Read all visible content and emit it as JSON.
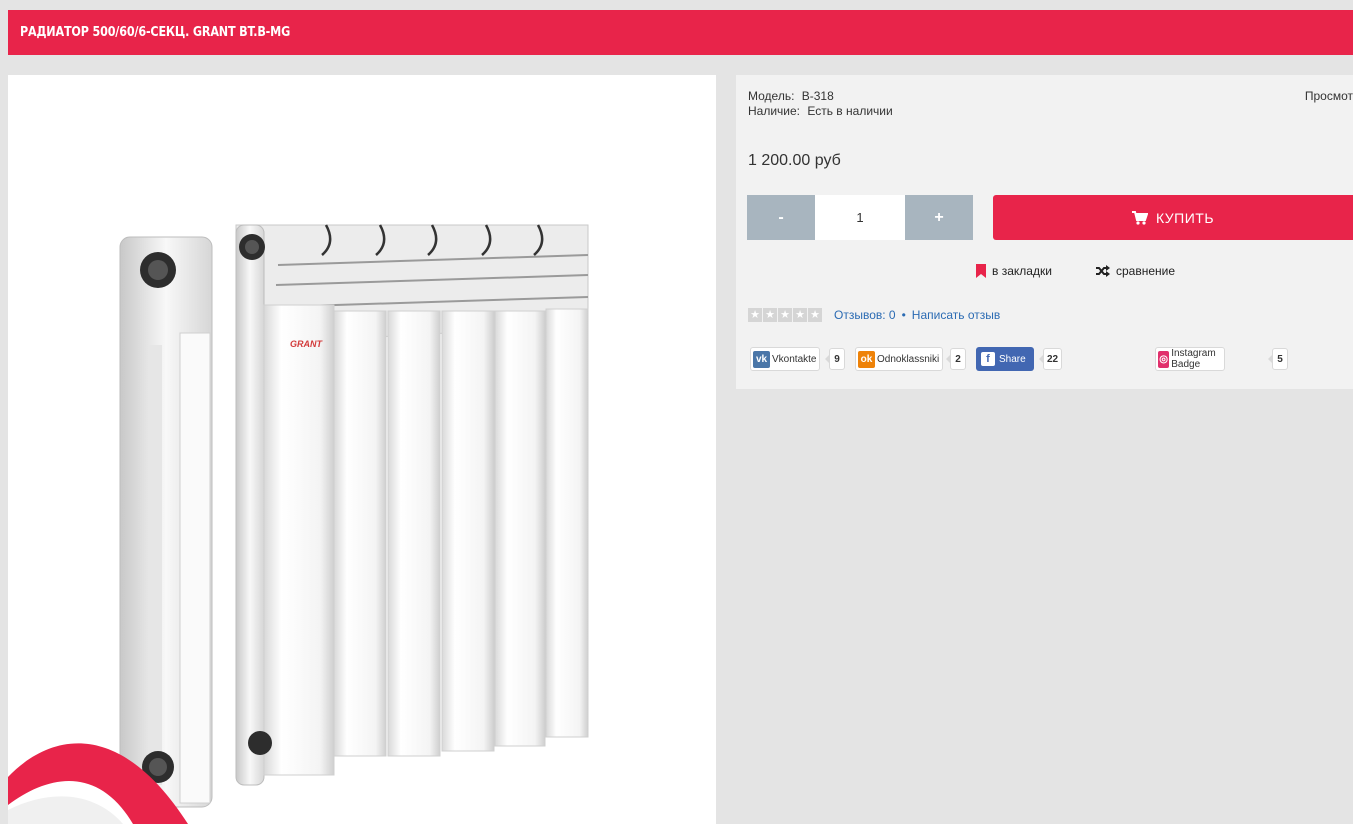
{
  "product": {
    "title": "РАДИАТОР 500/60/6-СЕКЦ. GRANT BT.B-MG",
    "image_brand_mark": "GRANT",
    "model_label": "Модель:",
    "model_value": "B-318",
    "availability_label": "Наличие:",
    "availability_value": "Есть в наличии",
    "views_label": "Просмот",
    "price": "1 200.00 руб"
  },
  "cart": {
    "minus_label": "-",
    "quantity": "1",
    "plus_label": "+",
    "buy_label": "КУПИТЬ",
    "buy_icon": "cart-icon"
  },
  "actions": {
    "bookmark_label": "в закладки",
    "bookmark_icon": "bookmark-icon",
    "compare_label": "сравнение",
    "compare_icon": "shuffle-icon"
  },
  "reviews": {
    "rating": 0,
    "max_rating": 5,
    "reviews_link": "Отзывов: 0",
    "separator": "•",
    "write_review_link": "Написать отзыв"
  },
  "social": {
    "vk": {
      "label": "Vkontakte",
      "count": "9",
      "color": "#4a76a8",
      "icon": "vk-icon"
    },
    "ok": {
      "label": "Odnoklassniki",
      "count": "2",
      "color": "#ee8208",
      "icon": "odnoklassniki-icon"
    },
    "fb": {
      "label": "Share",
      "count": "22",
      "color": "#4267b2",
      "icon": "facebook-icon"
    },
    "ig": {
      "label": "Instagram Badge",
      "count": "5",
      "color": "#e1306c",
      "icon": "instagram-icon"
    }
  },
  "colors": {
    "accent": "#e8244a",
    "qty_button": "#a8b5bf",
    "link": "#2b6bb3",
    "panel_bg": "#f2f2f2",
    "page_bg": "#e4e4e4"
  }
}
